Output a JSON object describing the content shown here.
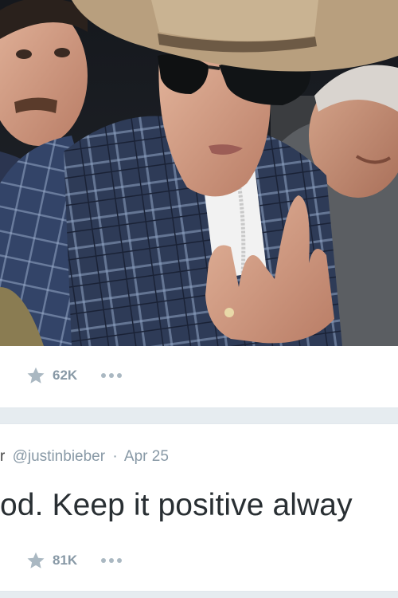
{
  "photo": {
    "colors": {
      "hat": "#b89f7e",
      "plaid": "#3a4a6a",
      "background": "#1a1d22"
    }
  },
  "tweet_top": {
    "favorites_count": "62K",
    "more_icon": "more-dots-icon",
    "star_icon": "star-icon"
  },
  "tweet_bottom": {
    "name_fragment": "r",
    "handle": "@justinbieber",
    "separator": "·",
    "date": "Apr 25",
    "text": "od. Keep it positive alway",
    "favorites_count": "81K",
    "more_icon": "more-dots-icon",
    "star_icon": "star-icon"
  },
  "colors": {
    "text_primary": "#292f33",
    "text_secondary": "#8899a6",
    "icon_gray": "#aab8c2",
    "page_bg": "#e6ecf0",
    "card_bg": "#ffffff"
  }
}
